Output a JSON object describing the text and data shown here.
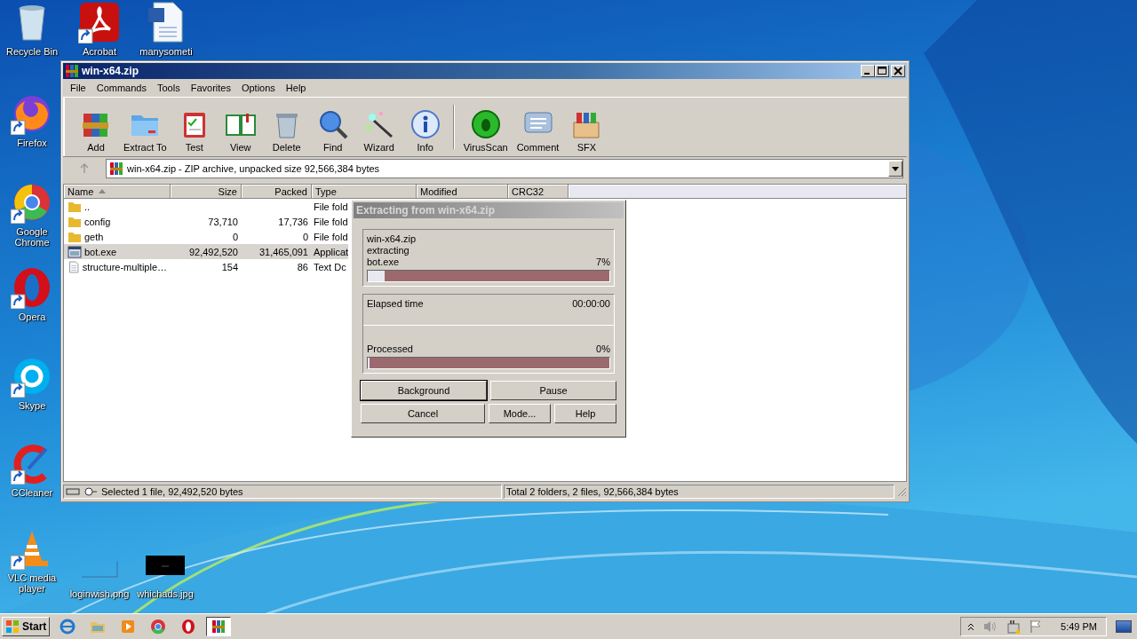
{
  "desktop_icons": [
    {
      "label": "Recycle Bin",
      "shortcut": false
    },
    {
      "label": "Acrobat",
      "shortcut": true
    },
    {
      "label": "manysometi",
      "shortcut": false
    },
    {
      "label": "Firefox",
      "shortcut": true
    },
    {
      "label": "Google Chrome",
      "shortcut": true
    },
    {
      "label": "Opera",
      "shortcut": true
    },
    {
      "label": "Skype",
      "shortcut": true
    },
    {
      "label": "CCleaner",
      "shortcut": true
    },
    {
      "label": "VLC media player",
      "shortcut": true
    },
    {
      "label": "loginwish.png",
      "shortcut": false
    },
    {
      "label": "whichads.jpg",
      "shortcut": false
    }
  ],
  "window": {
    "title": "win-x64.zip",
    "menu": [
      "File",
      "Commands",
      "Tools",
      "Favorites",
      "Options",
      "Help"
    ],
    "toolbar": [
      {
        "label": "Add"
      },
      {
        "label": "Extract To"
      },
      {
        "label": "Test"
      },
      {
        "label": "View"
      },
      {
        "label": "Delete"
      },
      {
        "label": "Find"
      },
      {
        "label": "Wizard"
      },
      {
        "label": "Info"
      },
      {
        "label": "VirusScan"
      },
      {
        "label": "Comment"
      },
      {
        "label": "SFX"
      }
    ],
    "address": "win-x64.zip - ZIP archive, unpacked size 92,566,384 bytes",
    "columns": [
      "Name",
      "Size",
      "Packed",
      "Type",
      "Modified",
      "CRC32"
    ],
    "rows": [
      {
        "kind": "folder",
        "name": "..",
        "size": "",
        "packed": "",
        "type": "File fold",
        "selected": false
      },
      {
        "kind": "folder",
        "name": "config",
        "size": "73,710",
        "packed": "17,736",
        "type": "File fold",
        "selected": false
      },
      {
        "kind": "folder",
        "name": "geth",
        "size": "0",
        "packed": "0",
        "type": "File fold",
        "selected": false
      },
      {
        "kind": "exe",
        "name": "bot.exe",
        "size": "92,492,520",
        "packed": "31,465,091",
        "type": "Applicat",
        "selected": true
      },
      {
        "kind": "text",
        "name": "structure-multiple…",
        "size": "154",
        "packed": "86",
        "type": "Text Dc",
        "selected": false
      }
    ],
    "status_left": "Selected 1 file, 92,492,520 bytes",
    "status_right": "Total 2 folders, 2 files, 92,566,384 bytes"
  },
  "dialog": {
    "title": "Extracting from win-x64.zip",
    "archive": "win-x64.zip",
    "action": "extracting",
    "file": "bot.exe",
    "file_percent": "7%",
    "file_progress": {
      "level": 0.07
    },
    "elapsed_label": "Elapsed time",
    "elapsed": "00:00:00",
    "processed_label": "Processed",
    "processed_percent": "0%",
    "total_progress": {
      "level": 0
    },
    "buttons": [
      {
        "label": "Background",
        "default": true
      },
      {
        "label": "Pause",
        "default": false
      },
      {
        "label": "Cancel",
        "default": false
      },
      {
        "label": "Mode...",
        "default": false
      },
      {
        "label": "Help",
        "default": false
      }
    ]
  },
  "taskbar": {
    "start": "Start",
    "buttons": [
      {
        "selected": false
      },
      {
        "selected": false
      },
      {
        "selected": false
      },
      {
        "selected": false
      },
      {
        "selected": false
      },
      {
        "selected": true
      }
    ],
    "clock": "5:49 PM"
  }
}
